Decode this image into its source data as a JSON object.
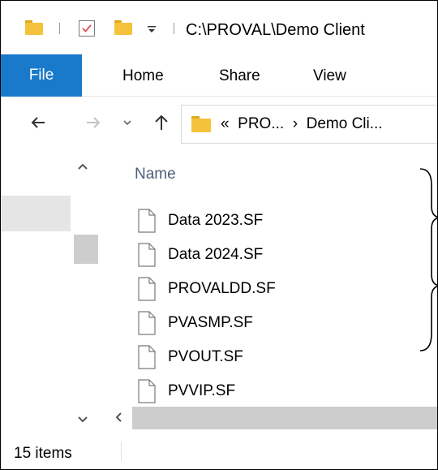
{
  "window": {
    "path_title": "C:\\PROVAL\\Demo Client"
  },
  "ribbon": {
    "tabs": [
      "File",
      "Home",
      "Share",
      "View"
    ]
  },
  "address_bar": {
    "prefix": "«",
    "crumb_1": "PRO...",
    "separator": "›",
    "crumb_2": "Demo Cli..."
  },
  "file_list": {
    "column_header": "Name",
    "files": [
      "Data 2023.SF",
      "Data 2024.SF",
      "PROVALDD.SF",
      "PVASMP.SF",
      "PVOUT.SF",
      "PVVIP.SF"
    ]
  },
  "status_bar": {
    "item_count": "15 items"
  },
  "colors": {
    "file_tab": "#1979CA",
    "folder": "#F5C33B",
    "header_text": "#4c607a"
  },
  "icons": [
    "folder-icon",
    "checkmark-icon",
    "dropdown-arrow-icon",
    "back-arrow-icon",
    "forward-arrow-icon",
    "recent-chevron-icon",
    "up-arrow-icon",
    "file-icon"
  ]
}
